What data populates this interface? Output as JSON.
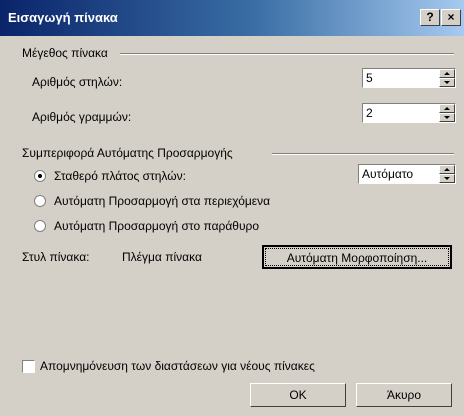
{
  "window": {
    "title": "Εισαγωγή πίνακα",
    "help_btn": "?",
    "close_btn": "×"
  },
  "table_size": {
    "group_label": "Μέγεθος πίνακα",
    "columns_label": "Αριθμός στηλών:",
    "columns_value": "5",
    "rows_label": "Αριθμός γραμμών:",
    "rows_value": "2"
  },
  "autofit": {
    "group_label": "Συμπεριφορά Αυτόματης Προσαρμογής",
    "fixed_width_label": "Σταθερό πλάτος στηλών:",
    "fixed_width_value": "Αυτόματο",
    "contents_label": "Αυτόματη Προσαρμογή στα περιεχόμενα",
    "window_label": "Αυτόματη Προσαρμογή στο παράθυρο",
    "selected": "fixed_width"
  },
  "table_style": {
    "label": "Στυλ πίνακα:",
    "value": "Πλέγμα πίνακα",
    "autoformat_button": "Αυτόματη Μορφοποίηση..."
  },
  "remember": {
    "label": "Απομνημόνευση των διαστάσεων για νέους πίνακες",
    "checked": false
  },
  "buttons": {
    "ok": "OK",
    "cancel": "Άκυρο"
  }
}
